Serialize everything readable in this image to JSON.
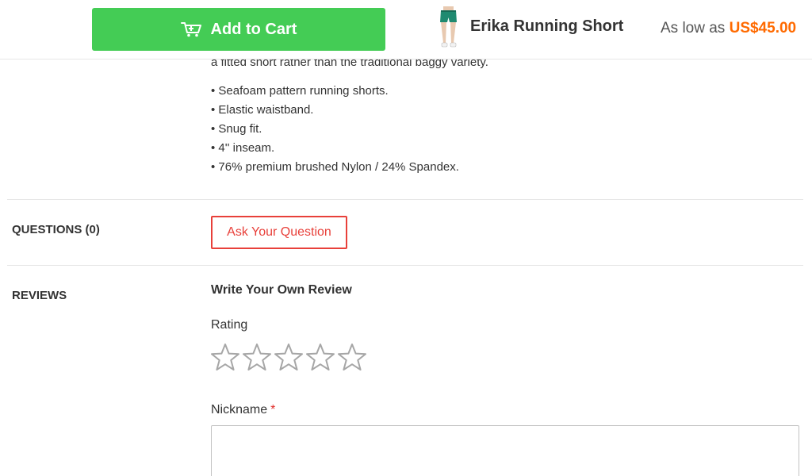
{
  "header": {
    "add_to_cart_label": "Add to Cart",
    "cart_icon": "cart-icon",
    "product_thumbnail": "product-thumbnail",
    "product_name": "Erika Running Short",
    "price_prefix": "As low as",
    "price": "US$45.00"
  },
  "description": {
    "partial_line": "a fitted short rather than the traditional baggy variety.",
    "features": [
      "• Seafoam pattern running shorts.",
      "• Elastic waistband.",
      "• Snug fit.",
      "• 4'' inseam.",
      "• 76% premium brushed Nylon / 24% Spandex."
    ]
  },
  "questions": {
    "label": "QUESTIONS (0)",
    "ask_button": "Ask Your Question"
  },
  "reviews": {
    "label": "REVIEWS",
    "form_title": "Write Your Own Review",
    "rating_label": "Rating",
    "stars_filled": 0,
    "stars_total": 5,
    "star_icon": "star-outline-icon",
    "nickname_label": "Nickname",
    "required_mark": "*",
    "nickname_value": ""
  },
  "colors": {
    "cart_button": "#44cc55",
    "price": "#ff6a00",
    "ask_button": "#e8403a",
    "required": "#e02b27"
  }
}
